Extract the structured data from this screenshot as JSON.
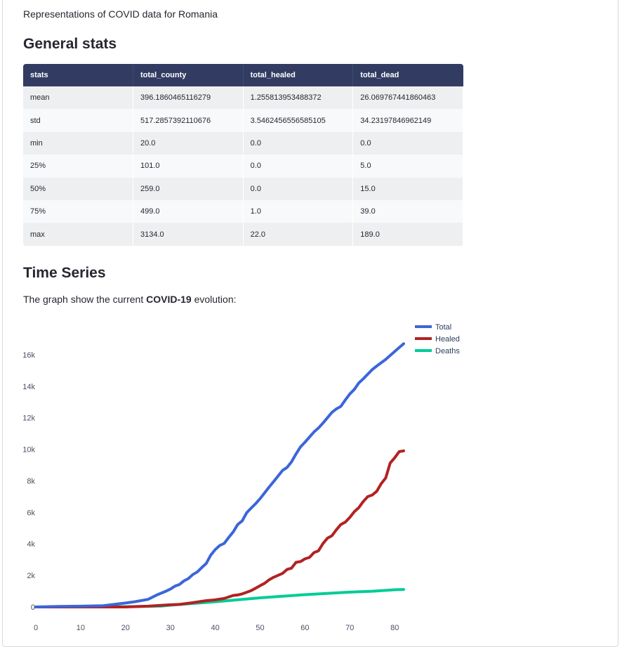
{
  "intro": "Representations of COVID data for Romania",
  "general_heading": "General stats",
  "table": {
    "headers": [
      "stats",
      "total_county",
      "total_healed",
      "total_dead"
    ],
    "rows": [
      [
        "mean",
        "396.1860465116279",
        "1.255813953488372",
        "26.069767441860463"
      ],
      [
        "std",
        "517.2857392110676",
        "3.5462456556585105",
        "34.23197846962149"
      ],
      [
        "min",
        "20.0",
        "0.0",
        "0.0"
      ],
      [
        "25%",
        "101.0",
        "0.0",
        "5.0"
      ],
      [
        "50%",
        "259.0",
        "0.0",
        "15.0"
      ],
      [
        "75%",
        "499.0",
        "1.0",
        "39.0"
      ],
      [
        "max",
        "3134.0",
        "22.0",
        "189.0"
      ]
    ]
  },
  "time_heading": "Time Series",
  "desc": {
    "pre": "The graph show the current ",
    "bold": "COVID-19",
    "post": " evolution:"
  },
  "chart_data": {
    "type": "line",
    "xlim": [
      0,
      82
    ],
    "ylim": [
      0,
      18000
    ],
    "xticks": [
      0,
      10,
      20,
      30,
      40,
      50,
      60,
      70,
      80
    ],
    "yticks": [
      0,
      2000,
      4000,
      6000,
      8000,
      10000,
      12000,
      14000,
      16000
    ],
    "ytick_labels": [
      "0",
      "2k",
      "4k",
      "6k",
      "8k",
      "10k",
      "12k",
      "14k",
      "16k"
    ],
    "legend_position": "top-right",
    "series": [
      {
        "name": "Total",
        "color": "#3b66d9",
        "x": [
          0,
          5,
          10,
          15,
          20,
          22,
          25,
          27,
          29,
          30,
          31,
          32,
          33,
          34,
          35,
          36,
          37,
          38,
          39,
          40,
          41,
          42,
          43,
          44,
          45,
          46,
          47,
          48,
          49,
          50,
          52,
          53,
          55,
          56,
          57,
          58,
          59,
          60,
          62,
          63,
          64,
          65,
          66,
          67,
          68,
          69,
          70,
          71,
          72,
          73,
          75,
          76,
          78,
          80,
          81,
          82
        ],
        "y": [
          0,
          30,
          50,
          80,
          250,
          330,
          480,
          760,
          1000,
          1130,
          1320,
          1420,
          1650,
          1800,
          2060,
          2220,
          2500,
          2760,
          3290,
          3640,
          3900,
          4030,
          4410,
          4760,
          5230,
          5460,
          5970,
          6270,
          6550,
          6870,
          7600,
          7950,
          8660,
          8850,
          9200,
          9700,
          10150,
          10450,
          11100,
          11350,
          11660,
          12000,
          12340,
          12560,
          12720,
          13130,
          13510,
          13800,
          14210,
          14470,
          15060,
          15280,
          15700,
          16200,
          16450,
          16700
        ]
      },
      {
        "name": "Healed",
        "color": "#b22222",
        "x": [
          0,
          10,
          20,
          25,
          30,
          32,
          35,
          38,
          40,
          42,
          44,
          45,
          46,
          47,
          48,
          49,
          50,
          51,
          52,
          53,
          55,
          56,
          57,
          58,
          59,
          60,
          61,
          62,
          63,
          64,
          65,
          66,
          67,
          68,
          69,
          70,
          71,
          72,
          73,
          74,
          75,
          76,
          77,
          78,
          79,
          80,
          81,
          82
        ],
        "y": [
          0,
          0,
          0,
          50,
          140,
          160,
          270,
          400,
          450,
          540,
          730,
          760,
          830,
          930,
          1040,
          1190,
          1350,
          1500,
          1720,
          1880,
          2130,
          2380,
          2460,
          2830,
          2880,
          3050,
          3140,
          3450,
          3560,
          4020,
          4360,
          4520,
          4890,
          5230,
          5380,
          5680,
          6040,
          6300,
          6690,
          7000,
          7100,
          7340,
          7820,
          8180,
          9130,
          9460,
          9850,
          9900
        ]
      },
      {
        "name": "Deaths",
        "color": "#00cc96",
        "x": [
          0,
          10,
          20,
          28,
          30,
          40,
          50,
          60,
          70,
          75,
          80,
          82
        ],
        "y": [
          0,
          0,
          20,
          60,
          110,
          330,
          580,
          780,
          940,
          1000,
          1090,
          1110
        ]
      }
    ]
  }
}
